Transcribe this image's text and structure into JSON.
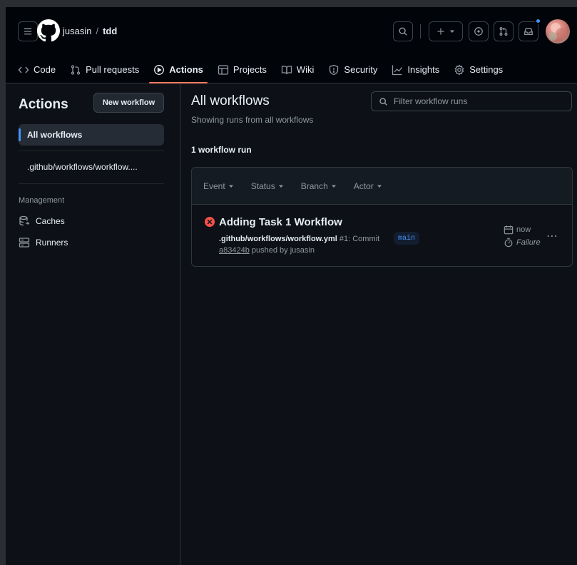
{
  "header": {
    "owner": "jusasin",
    "separator": "/",
    "repo": "tdd",
    "tabs": [
      {
        "label": "Code",
        "icon": "code-icon"
      },
      {
        "label": "Pull requests",
        "icon": "pull-request-icon"
      },
      {
        "label": "Actions",
        "icon": "play-icon",
        "active": true
      },
      {
        "label": "Projects",
        "icon": "table-icon"
      },
      {
        "label": "Wiki",
        "icon": "book-icon"
      },
      {
        "label": "Security",
        "icon": "shield-icon"
      },
      {
        "label": "Insights",
        "icon": "graph-icon"
      },
      {
        "label": "Settings",
        "icon": "gear-icon"
      }
    ]
  },
  "sidebar": {
    "title": "Actions",
    "new_workflow": "New workflow",
    "items": [
      {
        "label": "All workflows",
        "active": true
      },
      {
        "label": ".github/workflows/workflow...."
      }
    ],
    "management_heading": "Management",
    "management": [
      {
        "label": "Caches",
        "icon": "cache-icon"
      },
      {
        "label": "Runners",
        "icon": "server-icon"
      }
    ]
  },
  "main": {
    "title": "All workflows",
    "subtitle": "Showing runs from all workflows",
    "filter_placeholder": "Filter workflow runs",
    "count": "1 workflow run",
    "filters": [
      "Event",
      "Status",
      "Branch",
      "Actor"
    ],
    "run": {
      "title": "Adding Task 1 Workflow",
      "file": ".github/workflows/workflow.yml",
      "run_number": "#1: Commit",
      "sha": "a83424b",
      "pushed_by": "pushed by jusasin",
      "branch": "main",
      "time": "now",
      "status": "Failure"
    }
  },
  "colors": {
    "accent": "#4493f8",
    "failure": "#f85149",
    "tab_underline": "#f78166"
  }
}
